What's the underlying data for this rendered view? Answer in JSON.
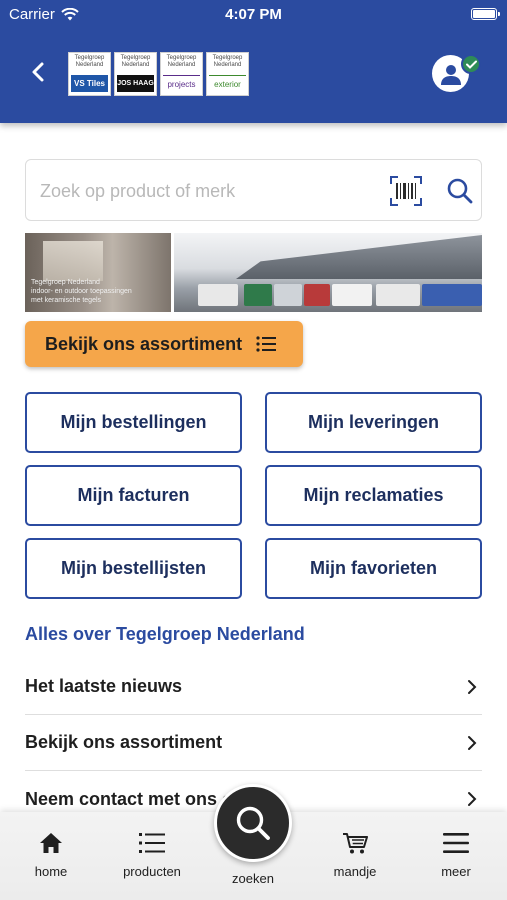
{
  "status_bar": {
    "carrier": "Carrier",
    "time": "4:07 PM"
  },
  "header": {
    "logos": [
      {
        "top": "Tegelgroep Nederland",
        "brand": "VS Tiles"
      },
      {
        "top": "Tegelgroep Nederland",
        "brand": "JOS HAAG"
      },
      {
        "top": "Tegelgroep Nederland",
        "brand": "projects"
      },
      {
        "top": "Tegelgroep Nederland",
        "brand": "exterior"
      }
    ],
    "account_status": "verified"
  },
  "search": {
    "placeholder": "Zoek op product of merk",
    "value": ""
  },
  "banner": {
    "left_caption": "Tegelgroep Nederland\nindoor- en outdoor toepassingen\nmet keramische tegels"
  },
  "assortiment_button": {
    "label": "Bekijk ons assortiment"
  },
  "grid": {
    "bestellingen": "Mijn bestellingen",
    "leveringen": "Mijn leveringen",
    "facturen": "Mijn facturen",
    "reclamaties": "Mijn reclamaties",
    "bestellijsten": "Mijn bestellijsten",
    "favorieten": "Mijn favorieten"
  },
  "section": {
    "title": "Alles over Tegelgroep Nederland",
    "items": [
      {
        "label": "Het laatste nieuws"
      },
      {
        "label": "Bekijk ons assortiment"
      },
      {
        "label": "Neem contact met ons op"
      }
    ]
  },
  "tabbar": {
    "home": "home",
    "producten": "producten",
    "zoeken": "zoeken",
    "mandje": "mandje",
    "meer": "meer"
  },
  "colors": {
    "brand_blue": "#2b4ba0",
    "accent_orange": "#f5a64a",
    "badge_green": "#2e8b57"
  }
}
